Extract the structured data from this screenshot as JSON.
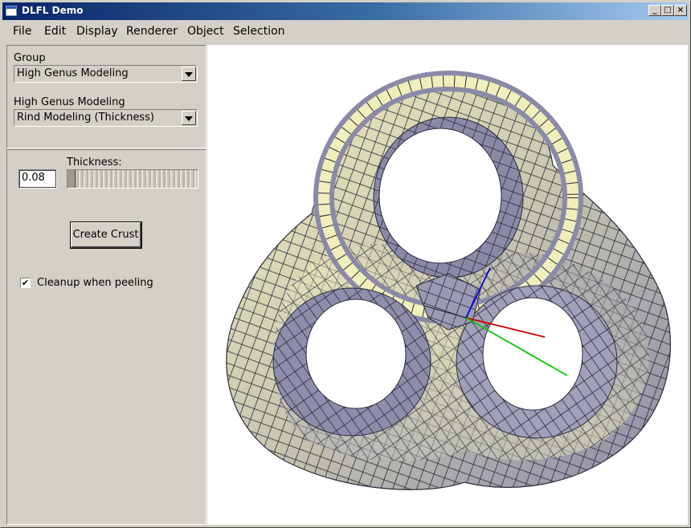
{
  "window": {
    "title": "DLFL Demo"
  },
  "menu": [
    "File",
    "Edit",
    "Display",
    "Renderer",
    "Object",
    "Selection"
  ],
  "group_panel": {
    "group_label": "Group",
    "group_value": "High Genus Modeling",
    "mode_label": "High Genus Modeling",
    "mode_value": "Rind Modeling (Thickness)"
  },
  "rind_panel": {
    "thickness_value": "0.08",
    "thickness_label": "Thickness:",
    "thickness_fraction": 0.0,
    "create_button": "Create Crust",
    "cleanup_label": "Cleanup when peeling",
    "cleanup_checked": true
  },
  "icons": {
    "minimize": "minimize-icon",
    "maximize": "maximize-icon",
    "close": "close-icon",
    "dropdown": "chevron-down-icon",
    "check": "checkmark-icon"
  },
  "colors": {
    "title_gradient_start": "#0a246a",
    "title_gradient_end": "#a6caf0",
    "face_light": "#f0eebb",
    "face_shade": "#8a8aa8",
    "axis_x": "#d00000",
    "axis_y": "#00c800",
    "axis_z": "#0000e0"
  }
}
